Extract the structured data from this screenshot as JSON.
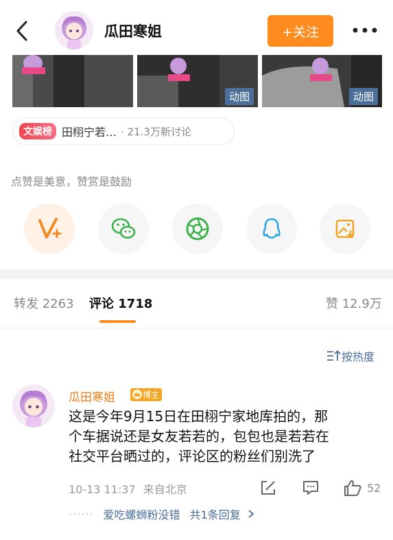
{
  "header": {
    "author_name": "瓜田寒姐",
    "follow_label": "+关注"
  },
  "media": {
    "gif_label": "动图"
  },
  "hot_tag": {
    "badge": "文娱榜",
    "title": "田栩宁若…",
    "meta": "· 21.3万新讨论"
  },
  "reward_hint": "点赞是美意，赞赏是鼓励",
  "tabs": {
    "reposts": "转发 2263",
    "comments": "评论 1718",
    "likes": "赞 12.9万"
  },
  "sort_label": "按热度",
  "comment": {
    "author": "瓜田寒姐",
    "badge": "博主",
    "lines": [
      "这是今年9月15日在田栩宁家地库拍的，那",
      "个车据说还是女友若若的，包包也是若若在",
      "社交平台晒过的，评论区的粉丝们别洗了"
    ],
    "time": "10-13 11:37",
    "location": "来自北京",
    "like_count": "52",
    "reply_user": "爱吃螺蛳粉没错",
    "reply_total": "共1条回复"
  },
  "colors": {
    "accent": "#ff8a1e",
    "link": "#4a6e9a",
    "wechat": "#3cb14a",
    "qq": "#2ea7e0"
  }
}
